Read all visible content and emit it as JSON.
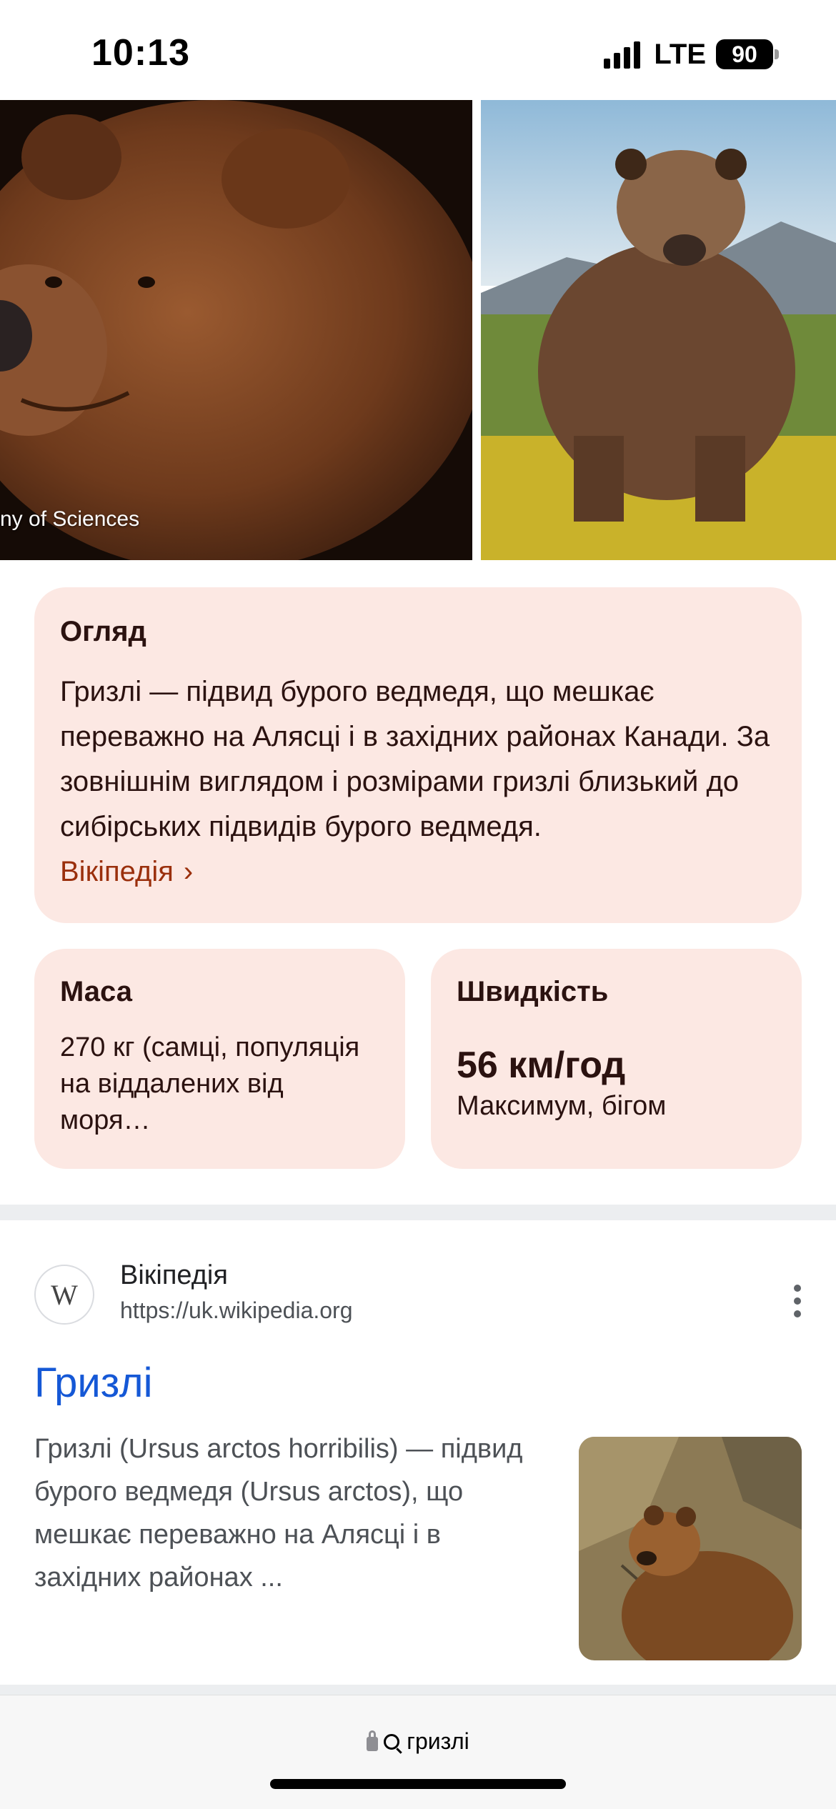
{
  "status_bar": {
    "time": "10:13",
    "network": "LTE",
    "battery": "90"
  },
  "images": {
    "left_credit": "ny of Sciences",
    "left_icon": "bear-head-photo",
    "right_icon": "bear-standing-photo"
  },
  "overview": {
    "title": "Огляд",
    "text": "Гризлі — підвид бурого ведмедя, що мешкає переважно на Алясці і в західних районах Канади. За зовнішнім виглядом і розмірами гризлі близький до сибірських підвидів бурого ведмедя.",
    "link_label": "Вікіпедія",
    "link_chevron": "›"
  },
  "facts": {
    "mass": {
      "title": "Маса",
      "text": "270 кг (самці, популяція на віддалених від моря…"
    },
    "speed": {
      "title": "Швидкість",
      "value": "56 км/год",
      "note": "Максимум, бігом"
    }
  },
  "result": {
    "favicon": "W",
    "site_name": "Вікіпедія",
    "url": "https://uk.wikipedia.org",
    "title": "Гризлі",
    "snippet": "Гризлі (Ursus arctos horribilis) — підвид бурого ведмедя (Ursus arctos), що мешкає переважно на Алясці і в західних районах ...",
    "thumbnail_icon": "bear-thumbnail"
  },
  "bottom_bar": {
    "query": "гризлі"
  },
  "colors": {
    "card_bg": "#fce8e3",
    "card_text": "#2b1210",
    "wiki_link": "#9a2f0c",
    "result_title": "#1558d6"
  }
}
